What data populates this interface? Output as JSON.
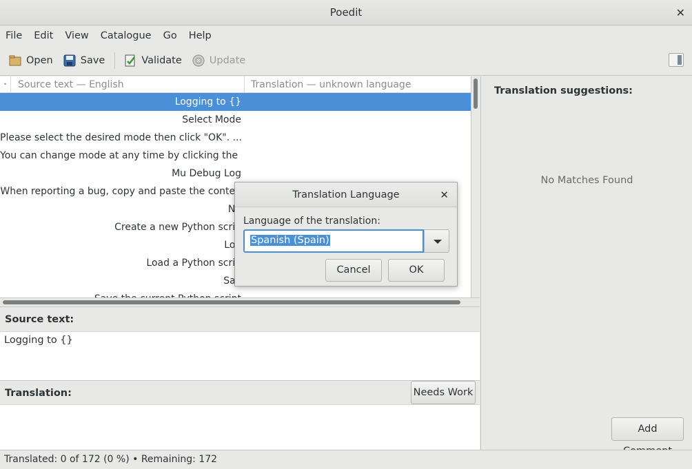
{
  "window": {
    "title": "Poedit"
  },
  "menu": [
    "File",
    "Edit",
    "View",
    "Catalogue",
    "Go",
    "Help"
  ],
  "toolbar": {
    "open": "Open",
    "save": "Save",
    "validate": "Validate",
    "update": "Update"
  },
  "list": {
    "col_source": "Source text — English",
    "col_translation": "Translation — unknown language",
    "rows": [
      "Logging to {}",
      "Select Mode",
      "Please select the desired mode then click \"OK\". ...",
      "You can change mode at any time by clicking the ...",
      "Mu Debug Log",
      "When reporting a bug, copy and paste the conten",
      "Ne",
      "Create a new Python scrip",
      "Loa",
      "Load a Python scrip",
      "Sav",
      "Save the current Python script"
    ]
  },
  "editor": {
    "source_label": "Source text:",
    "source_value": "Logging to {}",
    "translation_label": "Translation:",
    "needs_work": "Needs Work"
  },
  "sidebar": {
    "title": "Translation suggestions:",
    "empty": "No Matches Found",
    "add_comment": "Add Comment"
  },
  "status": {
    "text": "Translated: 0 of 172 (0 %)  •  Remaining: 172"
  },
  "dialog": {
    "title": "Translation Language",
    "label": "Language of the translation:",
    "value": "Spanish (Spain)",
    "cancel": "Cancel",
    "ok": "OK"
  },
  "colors": {
    "accent": "#4a90d9",
    "window_bg": "#e8e8e7"
  }
}
